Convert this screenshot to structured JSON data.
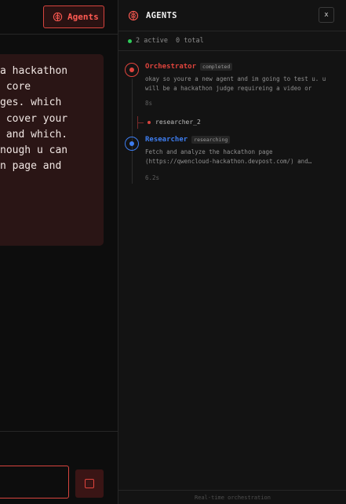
{
  "header": {
    "agents_button_label": "Agents"
  },
  "message": {
    "lines": [
      "a hackathon",
      " core",
      "ges. which",
      " cover your",
      " and which.",
      "nough u can",
      "n page and"
    ]
  },
  "panel": {
    "title": "AGENTS",
    "close_label": "x",
    "stats": {
      "active": "2 active",
      "total": "0 total"
    },
    "agents": [
      {
        "name": "Orchestrator",
        "status": "completed",
        "color": "#e0443d",
        "desc_lines": [
          "okay so youre a new agent and im going to test u. u",
          "will be a hackathon judge requireing a video or"
        ],
        "time": "8s"
      },
      {
        "name": "Researcher",
        "status": "researching",
        "color": "#3d7df0",
        "desc_lines": [
          "Fetch and analyze the hackathon page",
          "(https://qwencloud-hackathon.devpost.com/) and…"
        ],
        "time": "6.2s"
      }
    ],
    "child": {
      "label": "researcher_2"
    },
    "footer": "Real-time orchestration"
  },
  "colors": {
    "accent": "#e0443d",
    "active_dot": "#2ecc5a",
    "researcher": "#3d7df0"
  },
  "icons": [
    "brain-icon",
    "close-icon",
    "stop-icon"
  ]
}
